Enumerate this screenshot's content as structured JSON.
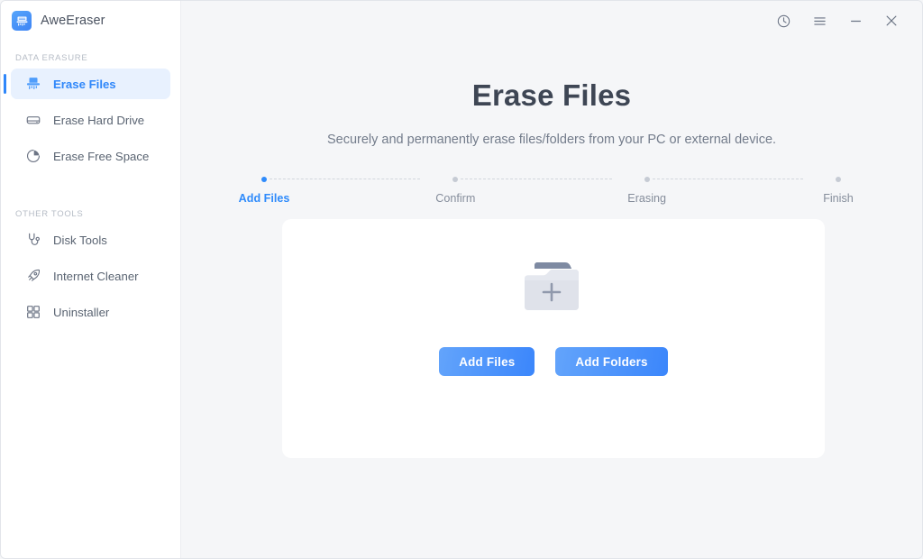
{
  "app": {
    "name": "AweEraser",
    "logo_icon": "shredder-icon",
    "accent_color": "#2f8bfb",
    "background_color": "#f5f6f8",
    "sidebar_color": "#ffffff"
  },
  "titlebar": {
    "buttons": [
      {
        "name": "history-icon",
        "label": "History"
      },
      {
        "name": "menu-icon",
        "label": "Menu"
      },
      {
        "name": "minimize-icon",
        "label": "Minimize"
      },
      {
        "name": "close-icon",
        "label": "Close"
      }
    ]
  },
  "sidebar": {
    "sections": [
      {
        "label": "DATA ERASURE",
        "items": [
          {
            "label": "Erase Files",
            "icon": "shredder-icon",
            "active": true
          },
          {
            "label": "Erase Hard Drive",
            "icon": "hard-drive-icon",
            "active": false
          },
          {
            "label": "Erase Free Space",
            "icon": "pie-chart-icon",
            "active": false
          }
        ]
      },
      {
        "label": "OTHER TOOLS",
        "items": [
          {
            "label": "Disk Tools",
            "icon": "stethoscope-icon",
            "active": false
          },
          {
            "label": "Internet Cleaner",
            "icon": "rocket-icon",
            "active": false
          },
          {
            "label": "Uninstaller",
            "icon": "grid-squares-icon",
            "active": false
          }
        ]
      }
    ]
  },
  "main": {
    "title": "Erase Files",
    "subtitle": "Securely and permanently erase files/folders from your PC or external device.",
    "stepper": {
      "steps": [
        {
          "label": "Add Files",
          "active": true
        },
        {
          "label": "Confirm",
          "active": false
        },
        {
          "label": "Erasing",
          "active": false
        },
        {
          "label": "Finish",
          "active": false
        }
      ],
      "active_dot_color": "#2f8bfb",
      "inactive_dot_color": "#c6cbd4"
    },
    "card": {
      "illustration": "folder-plus-icon",
      "buttons": [
        {
          "label": "Add Files",
          "name": "add-files-button"
        },
        {
          "label": "Add Folders",
          "name": "add-folders-button"
        }
      ]
    }
  }
}
